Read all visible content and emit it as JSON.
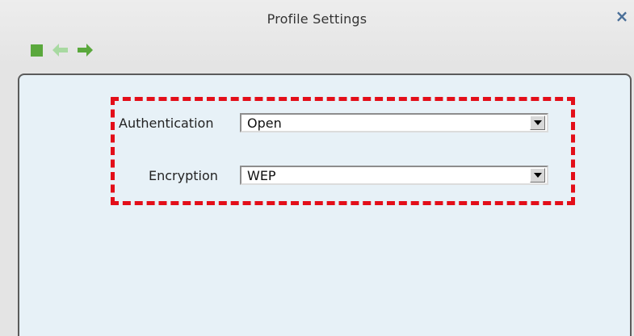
{
  "window": {
    "title": "Profile Settings",
    "close_icon": "close-icon"
  },
  "toolbar": {
    "icons": [
      {
        "name": "stop-icon"
      },
      {
        "name": "back-arrow-icon"
      },
      {
        "name": "forward-arrow-icon"
      }
    ]
  },
  "form": {
    "authentication": {
      "label": "Authentication",
      "value": "Open",
      "icon": "chevron-down-icon"
    },
    "encryption": {
      "label": "Encryption",
      "value": "WEP",
      "icon": "chevron-down-icon"
    }
  },
  "colors": {
    "highlight": "#e30e19",
    "toolbar_green": "#5aa83c",
    "panel_bg": "#e7f1f7"
  }
}
